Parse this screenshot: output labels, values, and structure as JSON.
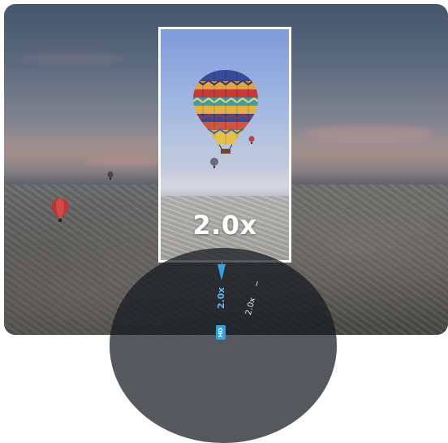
{
  "viewer": {
    "zoom_overlay_label": "2.0x",
    "dial": {
      "current_zoom": "2.0x",
      "quality_badge": "HD",
      "next_zoom": "2.0x"
    }
  },
  "colors": {
    "accent": "#2fa3e8",
    "frame": "#ffffff"
  }
}
